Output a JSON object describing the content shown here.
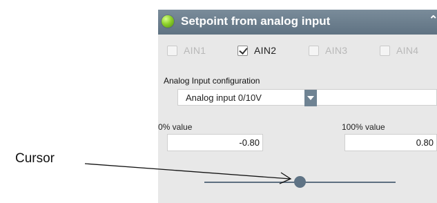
{
  "panel": {
    "title": "Setpoint from analog input",
    "status_icon": "status-dot-icon",
    "collapse_icon": "chevron-up-icon",
    "analog_inputs": [
      {
        "label": "AIN1",
        "checked": false
      },
      {
        "label": "AIN2",
        "checked": true
      },
      {
        "label": "AIN3",
        "checked": false
      },
      {
        "label": "AIN4",
        "checked": false
      }
    ],
    "config_label": "Analog Input configuration",
    "config_value": "Analog input 0/10V",
    "zero_percent": {
      "label": "0% value",
      "value": "-0.80"
    },
    "hundred_percent": {
      "label": "100% value",
      "value": "0.80"
    },
    "slider_position": 0.5
  },
  "annotation": {
    "label": "Cursor"
  },
  "colors": {
    "header": "#6b7f8f",
    "status": "#7fc41c",
    "slider": "#5f7385"
  }
}
